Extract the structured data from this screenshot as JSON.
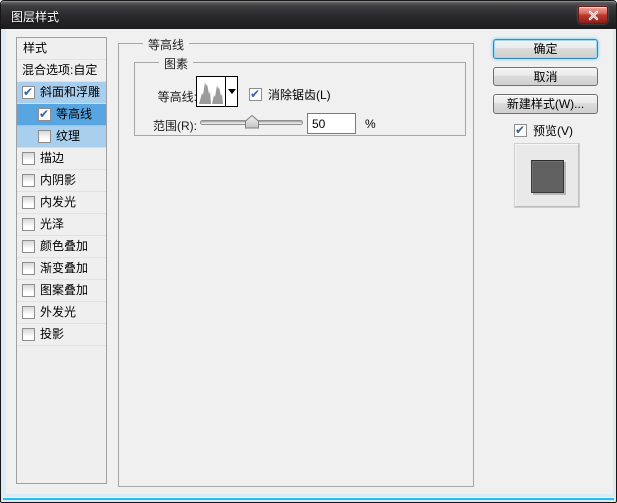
{
  "window": {
    "title": "图层样式"
  },
  "sidebar": {
    "header": "样式",
    "items": [
      {
        "label": "混合选项:自定",
        "checked": null,
        "highlight": "none",
        "indent": false
      },
      {
        "label": "斜面和浮雕",
        "checked": true,
        "highlight": "light",
        "indent": false
      },
      {
        "label": "等高线",
        "checked": true,
        "highlight": "selected",
        "indent": true
      },
      {
        "label": "纹理",
        "checked": false,
        "highlight": "light",
        "indent": true
      },
      {
        "label": "描边",
        "checked": false,
        "highlight": "none",
        "indent": false
      },
      {
        "label": "内阴影",
        "checked": false,
        "highlight": "none",
        "indent": false
      },
      {
        "label": "内发光",
        "checked": false,
        "highlight": "none",
        "indent": false
      },
      {
        "label": "光泽",
        "checked": false,
        "highlight": "none",
        "indent": false
      },
      {
        "label": "颜色叠加",
        "checked": false,
        "highlight": "none",
        "indent": false
      },
      {
        "label": "渐变叠加",
        "checked": false,
        "highlight": "none",
        "indent": false
      },
      {
        "label": "图案叠加",
        "checked": false,
        "highlight": "none",
        "indent": false
      },
      {
        "label": "外发光",
        "checked": false,
        "highlight": "none",
        "indent": false
      },
      {
        "label": "投影",
        "checked": false,
        "highlight": "none",
        "indent": false
      }
    ]
  },
  "panel": {
    "group_title": "等高线",
    "subgroup_title": "图素",
    "contour_label": "等高线:",
    "antialias_label": "消除锯齿(L)",
    "antialias_checked": true,
    "range_label": "范围(R):",
    "range_value": "50",
    "range_unit": "%",
    "range_percent": 50
  },
  "actions": {
    "ok_label": "确定",
    "cancel_label": "取消",
    "new_style_label": "新建样式(W)...",
    "preview_label": "预览(V)",
    "preview_checked": true
  },
  "colors": {
    "selection": "#58a6e1",
    "selection_light": "#a9cfee",
    "dialog_bg": "#f0f0f0",
    "titlebar": "#29292c",
    "close_button_red": "#c0392e",
    "frame_accent_cyan": "#27bdee",
    "ok_focus_border": "#2f8cc0",
    "preview_swatch_gray": "#606060"
  }
}
